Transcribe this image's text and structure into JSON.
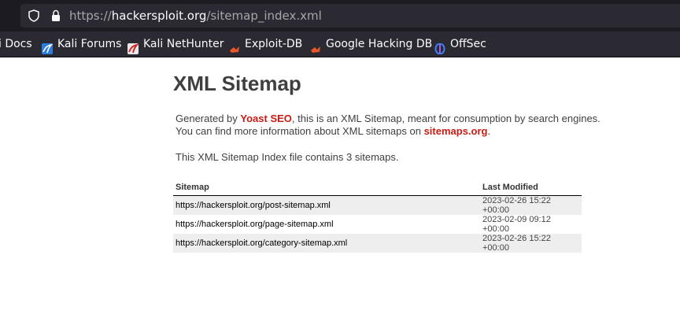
{
  "browser": {
    "url_scheme": "https://",
    "url_host": "hackersploit.org",
    "url_path": "/sitemap_index.xml",
    "icons": [
      "shield-icon",
      "lock-icon"
    ],
    "bookmarks": [
      {
        "label": "Kali Docs",
        "visible_label": "i Docs",
        "icon": "kali-icon"
      },
      {
        "label": "Kali Forums",
        "icon": "kali-icon"
      },
      {
        "label": "Kali NetHunter",
        "icon": "nethunter-icon"
      },
      {
        "label": "Exploit-DB",
        "icon": "exploit-db-icon"
      },
      {
        "label": "Google Hacking DB",
        "icon": "exploit-db-icon"
      },
      {
        "label": "OffSec",
        "icon": "offsec-icon"
      }
    ]
  },
  "page": {
    "title": "XML Sitemap",
    "desc_1": "Generated by ",
    "yoast_link": "Yoast SEO",
    "desc_2": ", this is an XML Sitemap, meant for consumption by search engines.",
    "desc_3": "You can find more information about XML sitemaps on ",
    "sitemaps_link": "sitemaps.org",
    "desc_4": ".",
    "count_text": "This XML Sitemap Index file contains 3 sitemaps.",
    "link_color": "#c81b14"
  },
  "table": {
    "headers": [
      "Sitemap",
      "Last Modified"
    ],
    "rows": [
      {
        "url": "https://hackersploit.org/post-sitemap.xml",
        "modified": "2023-02-26 15:22 +00:00"
      },
      {
        "url": "https://hackersploit.org/page-sitemap.xml",
        "modified": "2023-02-09 09:12 +00:00"
      },
      {
        "url": "https://hackersploit.org/category-sitemap.xml",
        "modified": "2023-02-26 15:22 +00:00"
      }
    ]
  }
}
